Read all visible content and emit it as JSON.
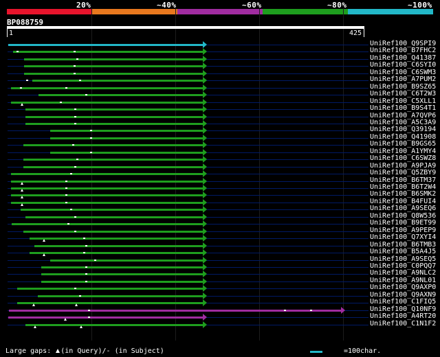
{
  "legend": {
    "colors": [
      "#e8142c",
      "#e8781e",
      "#a02ca0",
      "#1e9e1e",
      "#22b8c8"
    ],
    "labels": [
      "20%",
      "~40%",
      "~60%",
      "~80%",
      "~100%"
    ]
  },
  "query": {
    "id": "BP088759",
    "start": "1",
    "end": "425"
  },
  "footer": {
    "gap_text_1": "Large gaps:",
    "gap_text_2": "(in Query)/",
    "gap_text_3": "(in Subject)",
    "scale_text": "=100char."
  },
  "hits": [
    {
      "label": "UniRef100_Q9SPI9",
      "color": "#22b8c8",
      "start": 1,
      "end": 440,
      "gq": [],
      "gs": []
    },
    {
      "label": "UniRef100_B7FHC2",
      "color": "#1e9e1e",
      "start": 12,
      "end": 440,
      "gq": [],
      "gs": [
        20,
        148
      ]
    },
    {
      "label": "UniRef100_Q41387",
      "color": "#1e9e1e",
      "start": 37,
      "end": 440,
      "gq": [],
      "gs": [
        155
      ]
    },
    {
      "label": "UniRef100_C6SYI0",
      "color": "#1e9e1e",
      "start": 37,
      "end": 440,
      "gq": [],
      "gs": [
        148
      ]
    },
    {
      "label": "UniRef100_C6SWM3",
      "color": "#1e9e1e",
      "start": 37,
      "end": 440,
      "gq": [],
      "gs": [
        148
      ]
    },
    {
      "label": "UniRef100_A7PUM2",
      "color": "#1e9e1e",
      "start": 55,
      "end": 440,
      "gq": [],
      "gs": [
        42,
        160
      ]
    },
    {
      "label": "UniRef100_B9SZ65",
      "color": "#1e9e1e",
      "start": 8,
      "end": 440,
      "gq": [],
      "gs": [
        28,
        130
      ]
    },
    {
      "label": "UniRef100_C6T2W3",
      "color": "#1e9e1e",
      "start": 70,
      "end": 440,
      "gq": [],
      "gs": [
        175
      ]
    },
    {
      "label": "UniRef100_C5XLL1",
      "color": "#1e9e1e",
      "start": 8,
      "end": 440,
      "gq": [
        32
      ],
      "gs": [
        118
      ]
    },
    {
      "label": "UniRef100_B9S4T1",
      "color": "#1e9e1e",
      "start": 40,
      "end": 440,
      "gq": [],
      "gs": [
        150
      ]
    },
    {
      "label": "UniRef100_A7QVP6",
      "color": "#1e9e1e",
      "start": 40,
      "end": 440,
      "gq": [],
      "gs": [
        150
      ]
    },
    {
      "label": "UniRef100_A5C3A9",
      "color": "#1e9e1e",
      "start": 40,
      "end": 440,
      "gq": [],
      "gs": [
        150
      ]
    },
    {
      "label": "UniRef100_Q39194",
      "color": "#1e9e1e",
      "start": 95,
      "end": 440,
      "gq": [],
      "gs": [
        185
      ]
    },
    {
      "label": "UniRef100_Q41908",
      "color": "#1e9e1e",
      "start": 95,
      "end": 440,
      "gq": [],
      "gs": [
        185
      ]
    },
    {
      "label": "UniRef100_B9GS65",
      "color": "#1e9e1e",
      "start": 35,
      "end": 440,
      "gq": [],
      "gs": [
        145
      ]
    },
    {
      "label": "UniRef100_A1YMY4",
      "color": "#1e9e1e",
      "start": 95,
      "end": 440,
      "gq": [],
      "gs": [
        185
      ]
    },
    {
      "label": "UniRef100_C6SWZ8",
      "color": "#1e9e1e",
      "start": 35,
      "end": 440,
      "gq": [],
      "gs": [
        155
      ]
    },
    {
      "label": "UniRef100_A9PJA9",
      "color": "#1e9e1e",
      "start": 35,
      "end": 440,
      "gq": [],
      "gs": [
        150
      ]
    },
    {
      "label": "UniRef100_Q5ZBY9",
      "color": "#1e9e1e",
      "start": 8,
      "end": 440,
      "gq": [],
      "gs": [
        140
      ]
    },
    {
      "label": "UniRef100_B6TM37",
      "color": "#1e9e1e",
      "start": 8,
      "end": 440,
      "gq": [
        32
      ],
      "gs": [
        130
      ]
    },
    {
      "label": "UniRef100_B6T2W4",
      "color": "#1e9e1e",
      "start": 8,
      "end": 440,
      "gq": [
        32
      ],
      "gs": [
        130
      ]
    },
    {
      "label": "UniRef100_B6SMK2",
      "color": "#1e9e1e",
      "start": 8,
      "end": 440,
      "gq": [
        32
      ],
      "gs": [
        130
      ]
    },
    {
      "label": "UniRef100_B4FUI4",
      "color": "#1e9e1e",
      "start": 8,
      "end": 440,
      "gq": [
        32
      ],
      "gs": [
        130
      ]
    },
    {
      "label": "UniRef100_A9SEQ6",
      "color": "#1e9e1e",
      "start": 30,
      "end": 440,
      "gq": [],
      "gs": [
        140
      ]
    },
    {
      "label": "UniRef100_Q8W536",
      "color": "#1e9e1e",
      "start": 40,
      "end": 440,
      "gq": [],
      "gs": [
        150
      ]
    },
    {
      "label": "UniRef100_B9ET99",
      "color": "#1e9e1e",
      "start": 10,
      "end": 440,
      "gq": [],
      "gs": [
        135
      ]
    },
    {
      "label": "UniRef100_A9PEP9",
      "color": "#1e9e1e",
      "start": 35,
      "end": 440,
      "gq": [],
      "gs": [
        150
      ]
    },
    {
      "label": "UniRef100_Q7XYI4",
      "color": "#1e9e1e",
      "start": 50,
      "end": 440,
      "gq": [
        82
      ],
      "gs": [
        170
      ]
    },
    {
      "label": "UniRef100_B6TMB3",
      "color": "#1e9e1e",
      "start": 60,
      "end": 440,
      "gq": [],
      "gs": [
        175
      ]
    },
    {
      "label": "UniRef100_B5A4J5",
      "color": "#1e9e1e",
      "start": 50,
      "end": 440,
      "gq": [
        82
      ],
      "gs": [
        170
      ]
    },
    {
      "label": "UniRef100_A9SEQ5",
      "color": "#1e9e1e",
      "start": 95,
      "end": 440,
      "gq": [],
      "gs": [
        195
      ]
    },
    {
      "label": "UniRef100_C0PQQ7",
      "color": "#1e9e1e",
      "start": 75,
      "end": 440,
      "gq": [],
      "gs": [
        175
      ]
    },
    {
      "label": "UniRef100_A9NLC2",
      "color": "#1e9e1e",
      "start": 75,
      "end": 440,
      "gq": [],
      "gs": [
        175
      ]
    },
    {
      "label": "UniRef100_A9NL01",
      "color": "#1e9e1e",
      "start": 75,
      "end": 440,
      "gq": [],
      "gs": [
        175
      ]
    },
    {
      "label": "UniRef100_Q9AXP0",
      "color": "#1e9e1e",
      "start": 22,
      "end": 440,
      "gq": [],
      "gs": [
        150
      ]
    },
    {
      "label": "UniRef100_Q9AXN9",
      "color": "#1e9e1e",
      "start": 68,
      "end": 440,
      "gq": [],
      "gs": [
        160
      ]
    },
    {
      "label": "UniRef100_C1FIQ5",
      "color": "#1e9e1e",
      "start": 22,
      "end": 440,
      "gq": [
        58,
        155
      ],
      "gs": []
    },
    {
      "label": "UniRef100_Q10NF9",
      "color": "#a02ca0",
      "start": 3,
      "end": 750,
      "gq": [],
      "gs": [
        180,
        620,
        680
      ]
    },
    {
      "label": "UniRef100_A4RT20",
      "color": "#a02ca0",
      "start": 1,
      "end": 440,
      "gq": [
        130
      ],
      "gs": [
        180
      ]
    },
    {
      "label": "UniRef100_C1N1F2",
      "color": "#1e9e1e",
      "start": 40,
      "end": 440,
      "gq": [
        62,
        165
      ],
      "gs": []
    }
  ]
}
